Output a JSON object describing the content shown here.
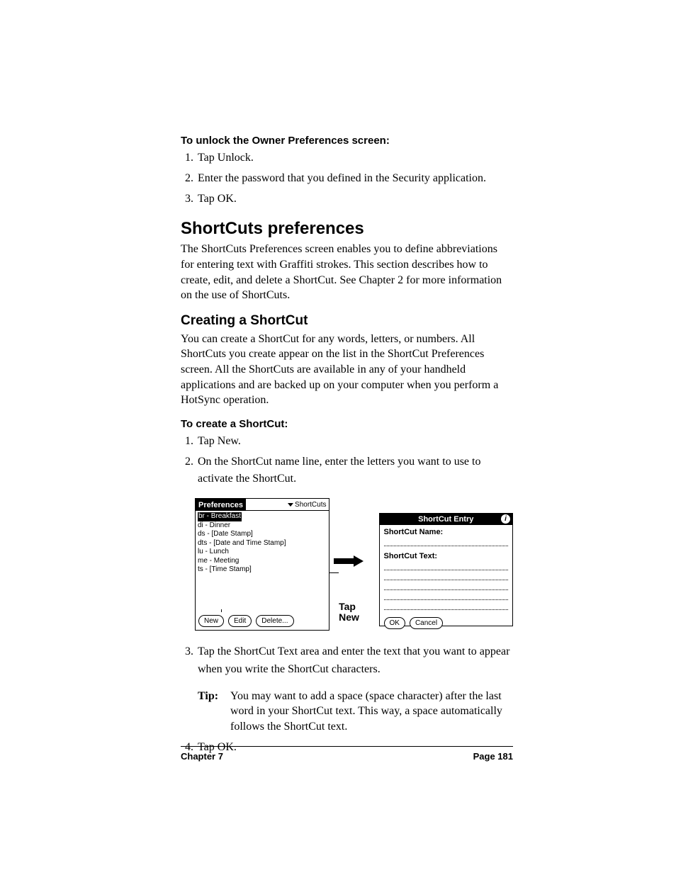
{
  "unlock": {
    "heading": "To unlock the Owner Preferences screen:",
    "steps": [
      "Tap Unlock.",
      "Enter the password that you defined in the Security application.",
      "Tap OK."
    ]
  },
  "section_title": "ShortCuts preferences",
  "section_body": "The ShortCuts Preferences screen enables you to define abbreviations for entering text with Graffiti strokes. This section describes how to create, edit, and delete a ShortCut. See Chapter 2 for more information on the use of ShortCuts.",
  "sub_title": "Creating a ShortCut",
  "sub_body": "You can create a ShortCut for any words, letters, or numbers. All ShortCuts you create appear on the list in the ShortCut Preferences screen. All the ShortCuts are available in any of your handheld applications and are backed up on your computer when you perform a HotSync operation.",
  "create": {
    "heading": "To create a ShortCut:",
    "steps_a": [
      "Tap New.",
      "On the ShortCut name line, enter the letters you want to use to activate the ShortCut."
    ],
    "steps_b": [
      "Tap the ShortCut Text area and enter the text that you want to appear when you write the ShortCut characters."
    ],
    "tip_label": "Tip:",
    "tip_text": "You may want to add a space (space character) after the last word in your ShortCut text. This way, a space automatically follows the ShortCut text.",
    "steps_c": [
      "Tap OK."
    ]
  },
  "palm_left": {
    "title": "Preferences",
    "menu": "ShortCuts",
    "items": [
      "br - Breakfast",
      "di - Dinner",
      "ds - [Date Stamp]",
      "dts - [Date and Time Stamp]",
      "lu - Lunch",
      "me - Meeting",
      "ts - [Time Stamp]"
    ],
    "btn_new": "New",
    "btn_edit": "Edit",
    "btn_delete": "Delete..."
  },
  "callout": "Tap\nNew",
  "palm_right": {
    "title": "ShortCut Entry",
    "name_label": "ShortCut Name:",
    "text_label": "ShortCut Text:",
    "btn_ok": "OK",
    "btn_cancel": "Cancel"
  },
  "footer": {
    "left": "Chapter 7",
    "right": "Page 181"
  }
}
